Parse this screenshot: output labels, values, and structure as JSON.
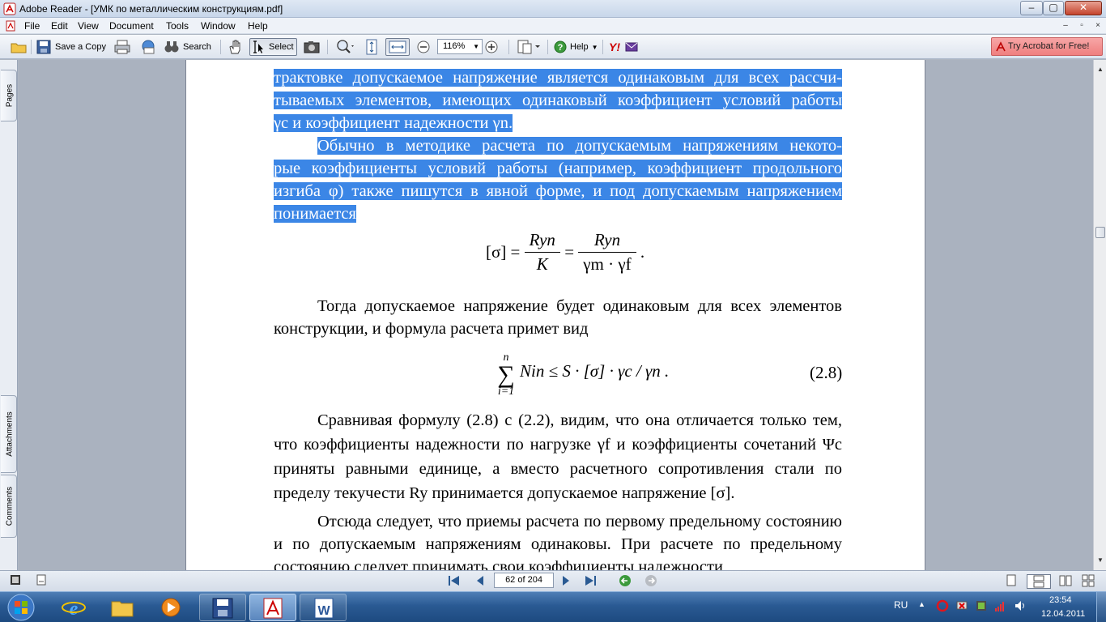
{
  "window": {
    "title": "Adobe Reader - [УМК по металлическим конструкциям.pdf]",
    "minimize": "–",
    "maximize": "▢",
    "close": "✕"
  },
  "menu": {
    "items": [
      "File",
      "Edit",
      "View",
      "Document",
      "Tools",
      "Window",
      "Help"
    ],
    "mdi_minimize": "–",
    "mdi_restore": "▫",
    "mdi_close": "×"
  },
  "toolbar": {
    "save_copy": "Save a Copy",
    "search": "Search",
    "select": "Select",
    "zoom_value": "116%",
    "help": "Help",
    "try_acrobat": "Try Acrobat for Free!",
    "yahoo": "Y!"
  },
  "nav_tabs": {
    "pages": "Pages",
    "attachments": "Attachments",
    "comments": "Comments"
  },
  "document": {
    "para1_highlighted": [
      "трактовке допускаемое напряжение является одинаковым для всех рассчи-",
      "тываемых элементов, имеющих одинаковый коэффициент условий работы",
      "γc и коэффициент надежности γn."
    ],
    "para2_highlighted": [
      "Обычно в методике расчета по допускаемым напряжениям некото-",
      "рые коэффициенты условий работы (например, коэффициент продольного",
      "изгиба φ) также пишутся в явной форме, и под допускаемым напряжением",
      "понимается"
    ],
    "formula1": {
      "lhs": "[σ] =",
      "num1": "Ryn",
      "den1": "K",
      "eq": "=",
      "num2": "Ryn",
      "den2": "γm · γf",
      "end": "."
    },
    "para3": "Тогда допускаемое напряжение будет одинаковым для всех элементов конструкции, и формула расчета примет вид",
    "formula2": {
      "sum_top": "n",
      "sum": "∑",
      "sum_bottom": "i=1",
      "body": "Nin ≤ S · [σ] · γc / γn .",
      "number": "(2.8)"
    },
    "para4": "Сравнивая формулу (2.8) с (2.2), видим, что она отличается только тем, что коэффициенты надежности по нагрузке γf и коэффициенты сочетаний Ψc приняты равными единице, а вместо расчетного сопротивления стали по пределу текучести Ry принимается допускаемое напряжение [σ].",
    "para5": "Отсюда следует, что приемы расчета по первому предельному состоянию и по допускаемым напряжениям одинаковы. При расчете по предельному состоянию следует принимать свои коэффициенты надежности"
  },
  "statusbar": {
    "page_indicator": "62 of 204"
  },
  "taskbar": {
    "language": "RU",
    "time": "23:54",
    "date": "12.04.2011"
  },
  "colors": {
    "highlight": "#3b86e6",
    "try_acrobat_bg": "#ef7f7f",
    "taskbar": "#2a5a93"
  }
}
